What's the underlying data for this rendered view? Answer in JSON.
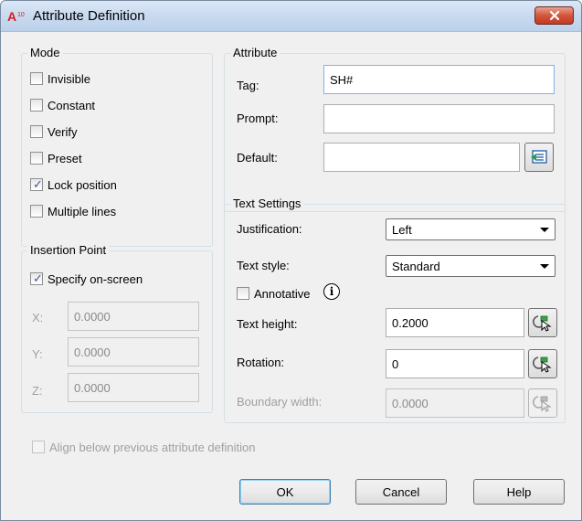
{
  "window": {
    "title": "Attribute Definition",
    "app_icon_text": "A10"
  },
  "mode": {
    "title": "Mode",
    "options": [
      {
        "label": "Invisible",
        "checked": false
      },
      {
        "label": "Constant",
        "checked": false
      },
      {
        "label": "Verify",
        "checked": false
      },
      {
        "label": "Preset",
        "checked": false
      },
      {
        "label": "Lock position",
        "checked": true
      },
      {
        "label": "Multiple lines",
        "checked": false
      }
    ]
  },
  "insertion": {
    "title": "Insertion Point",
    "specify_label": "Specify on-screen",
    "specify_checked": true,
    "x_label": "X:",
    "x_value": "0.0000",
    "y_label": "Y:",
    "y_value": "0.0000",
    "z_label": "Z:",
    "z_value": "0.0000"
  },
  "attribute": {
    "title": "Attribute",
    "tag_label": "Tag:",
    "tag_value": "SH#",
    "prompt_label": "Prompt:",
    "prompt_value": "",
    "default_label": "Default:",
    "default_value": ""
  },
  "text_settings": {
    "title": "Text Settings",
    "justification_label": "Justification:",
    "justification_value": "Left",
    "text_style_label": "Text style:",
    "text_style_value": "Standard",
    "annotative_label": "Annotative",
    "annotative_checked": false,
    "text_height_label": "Text height:",
    "text_height_value": "0.2000",
    "rotation_label": "Rotation:",
    "rotation_value": "0",
    "boundary_width_label": "Boundary width:",
    "boundary_width_value": "0.0000"
  },
  "align_label": "Align below previous attribute definition",
  "buttons": {
    "ok": "OK",
    "cancel": "Cancel",
    "help": "Help"
  }
}
